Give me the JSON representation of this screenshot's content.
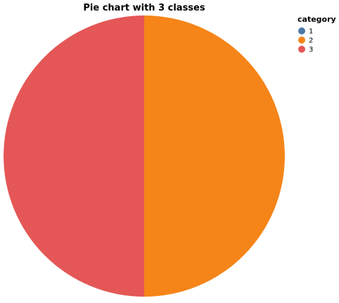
{
  "chart_data": {
    "type": "pie",
    "title": "Pie chart with 3 classes",
    "legend": {
      "title": "category",
      "position": "top-right"
    },
    "slices": [
      {
        "label": "1",
        "value": 0,
        "color": "#4c78a8"
      },
      {
        "label": "2",
        "value": 50,
        "color": "#f58518"
      },
      {
        "label": "3",
        "value": 50,
        "color": "#e45756"
      }
    ]
  }
}
